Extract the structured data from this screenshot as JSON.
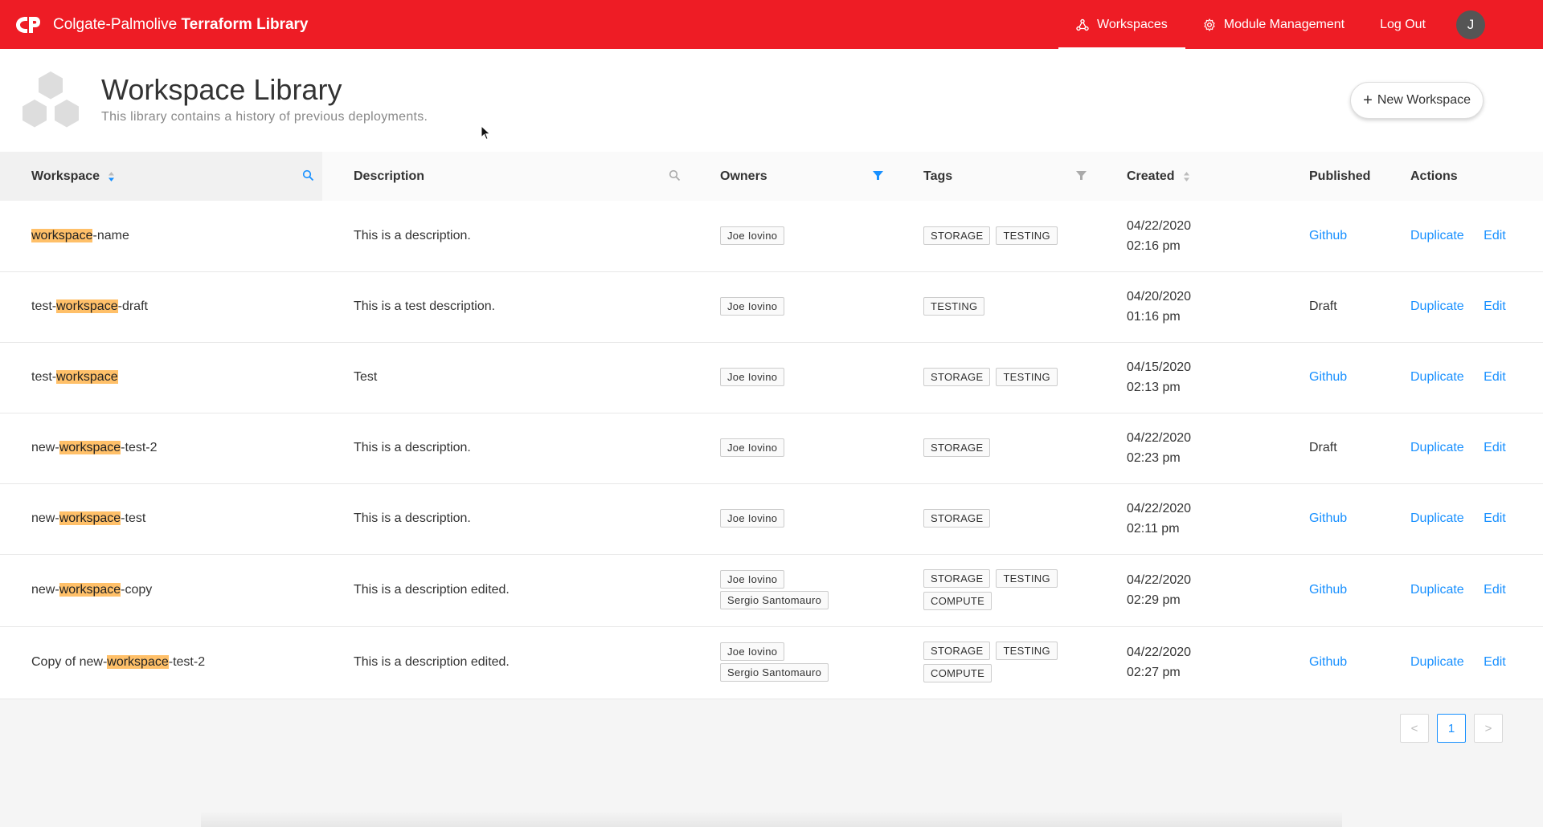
{
  "header": {
    "brand_prefix": "Colgate-Palmolive",
    "brand_suffix": "Terraform Library",
    "nav": {
      "workspaces": "Workspaces",
      "module_management": "Module Management",
      "logout": "Log Out"
    },
    "avatar_initial": "J"
  },
  "page": {
    "title": "Workspace Library",
    "subtitle": "This library contains a history of previous deployments.",
    "new_button": "New Workspace",
    "new_button_plus": "+"
  },
  "table": {
    "columns": {
      "workspace": "Workspace",
      "description": "Description",
      "owners": "Owners",
      "tags": "Tags",
      "created": "Created",
      "published": "Published",
      "actions": "Actions"
    },
    "highlight_term": "workspace",
    "rows": [
      {
        "name_pre": "",
        "name_hl": "workspace",
        "name_post": "-name",
        "description": "This is a description.",
        "owners": [
          "Joe Iovino"
        ],
        "tags": [
          "STORAGE",
          "TESTING"
        ],
        "date": "04/22/2020",
        "time": "02:16 pm",
        "published": "Github",
        "published_link": true,
        "duplicate": "Duplicate",
        "edit": "Edit"
      },
      {
        "name_pre": "test-",
        "name_hl": "workspace",
        "name_post": "-draft",
        "description": "This is a test description.",
        "owners": [
          "Joe Iovino"
        ],
        "tags": [
          "TESTING"
        ],
        "date": "04/20/2020",
        "time": "01:16 pm",
        "published": "Draft",
        "published_link": false,
        "duplicate": "Duplicate",
        "edit": "Edit"
      },
      {
        "name_pre": "test-",
        "name_hl": "workspace",
        "name_post": "",
        "description": "Test",
        "owners": [
          "Joe Iovino"
        ],
        "tags": [
          "STORAGE",
          "TESTING"
        ],
        "date": "04/15/2020",
        "time": "02:13 pm",
        "published": "Github",
        "published_link": true,
        "duplicate": "Duplicate",
        "edit": "Edit"
      },
      {
        "name_pre": "new-",
        "name_hl": "workspace",
        "name_post": "-test-2",
        "description": "This is a description.",
        "owners": [
          "Joe Iovino"
        ],
        "tags": [
          "STORAGE"
        ],
        "date": "04/22/2020",
        "time": "02:23 pm",
        "published": "Draft",
        "published_link": false,
        "duplicate": "Duplicate",
        "edit": "Edit"
      },
      {
        "name_pre": "new-",
        "name_hl": "workspace",
        "name_post": "-test",
        "description": "This is a description.",
        "owners": [
          "Joe Iovino"
        ],
        "tags": [
          "STORAGE"
        ],
        "date": "04/22/2020",
        "time": "02:11 pm",
        "published": "Github",
        "published_link": true,
        "duplicate": "Duplicate",
        "edit": "Edit"
      },
      {
        "name_pre": "new-",
        "name_hl": "workspace",
        "name_post": "-copy",
        "description": "This is a description edited.",
        "owners": [
          "Joe Iovino",
          "Sergio Santomauro"
        ],
        "tags": [
          "STORAGE",
          "TESTING",
          "COMPUTE"
        ],
        "date": "04/22/2020",
        "time": "02:29 pm",
        "published": "Github",
        "published_link": true,
        "duplicate": "Duplicate",
        "edit": "Edit"
      },
      {
        "name_pre": "Copy of new-",
        "name_hl": "workspace",
        "name_post": "-test-2",
        "description": "This is a description edited.",
        "owners": [
          "Joe Iovino",
          "Sergio Santomauro"
        ],
        "tags": [
          "STORAGE",
          "TESTING",
          "COMPUTE"
        ],
        "date": "04/22/2020",
        "time": "02:27 pm",
        "published": "Github",
        "published_link": true,
        "duplicate": "Duplicate",
        "edit": "Edit"
      }
    ]
  },
  "pagination": {
    "prev": "<",
    "current": "1",
    "next": ">"
  },
  "colors": {
    "brand_red": "#ee1c25",
    "link_blue": "#1890ff",
    "highlight": "#ffc069"
  },
  "icons": {
    "workspaces": "workspaces-icon",
    "module_management": "gear-icon",
    "search": "search-icon",
    "filter": "filter-icon",
    "sort": "sort-icon"
  }
}
